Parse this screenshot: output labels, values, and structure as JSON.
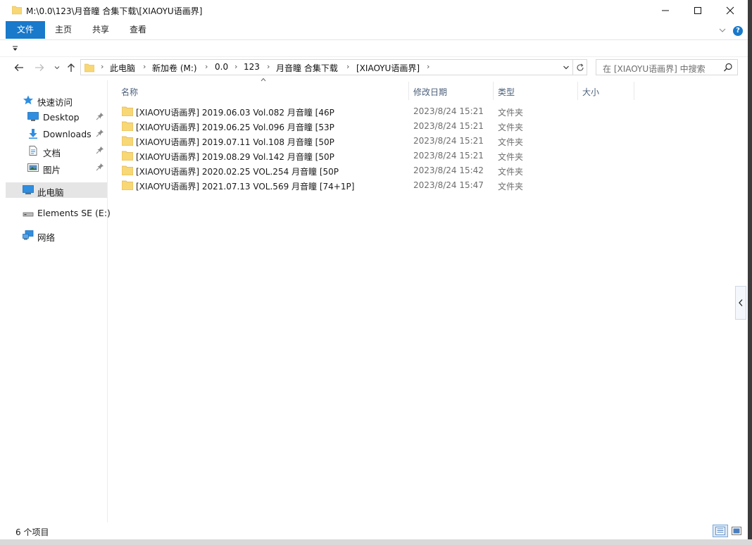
{
  "window": {
    "title": "M:\\0.0\\123\\月音瞳 合集下载\\[XIAOYU语画界]"
  },
  "ribbon": {
    "tabs": [
      {
        "label": "文件"
      },
      {
        "label": "主页"
      },
      {
        "label": "共享"
      },
      {
        "label": "查看"
      }
    ]
  },
  "address": {
    "crumbs": [
      "此电脑",
      "新加卷 (M:)",
      "0.0",
      "123",
      "月音瞳 合集下载",
      "[XIAOYU语画界]"
    ],
    "separator": "›"
  },
  "search": {
    "placeholder": "在 [XIAOYU语画界] 中搜索"
  },
  "navpane": {
    "items": [
      {
        "label": "快速访问",
        "icon": "star-icon"
      },
      {
        "label": "Desktop",
        "icon": "desktop-icon",
        "pinned": true
      },
      {
        "label": "Downloads",
        "icon": "download-icon",
        "pinned": true
      },
      {
        "label": "文档",
        "icon": "document-icon",
        "pinned": true
      },
      {
        "label": "图片",
        "icon": "picture-icon",
        "pinned": true
      },
      {
        "label": "此电脑",
        "icon": "computer-icon",
        "selected": true
      },
      {
        "label": "Elements SE (E:)",
        "icon": "drive-icon"
      },
      {
        "label": "网络",
        "icon": "network-icon"
      }
    ]
  },
  "columns": {
    "name": "名称",
    "date": "修改日期",
    "type": "类型",
    "size": "大小"
  },
  "files": [
    {
      "name": "[XIAOYU语画界] 2019.06.03 Vol.082 月音瞳 [46P",
      "date": "2023/8/24 15:21",
      "type": "文件夹"
    },
    {
      "name": "[XIAOYU语画界] 2019.06.25 Vol.096 月音瞳 [53P",
      "date": "2023/8/24 15:21",
      "type": "文件夹"
    },
    {
      "name": "[XIAOYU语画界] 2019.07.11 Vol.108 月音瞳 [50P",
      "date": "2023/8/24 15:21",
      "type": "文件夹"
    },
    {
      "name": "[XIAOYU语画界] 2019.08.29 Vol.142 月音瞳 [50P",
      "date": "2023/8/24 15:21",
      "type": "文件夹"
    },
    {
      "name": "[XIAOYU语画界] 2020.02.25 VOL.254 月音瞳 [50P",
      "date": "2023/8/24 15:42",
      "type": "文件夹"
    },
    {
      "name": "[XIAOYU语画界] 2021.07.13 VOL.569 月音瞳 [74+1P]",
      "date": "2023/8/24 15:47",
      "type": "文件夹"
    }
  ],
  "status": {
    "count": "6 个项目"
  },
  "colors": {
    "accent": "#1979ca",
    "folder": "#f8d775",
    "selected": "#e5e5e5"
  }
}
